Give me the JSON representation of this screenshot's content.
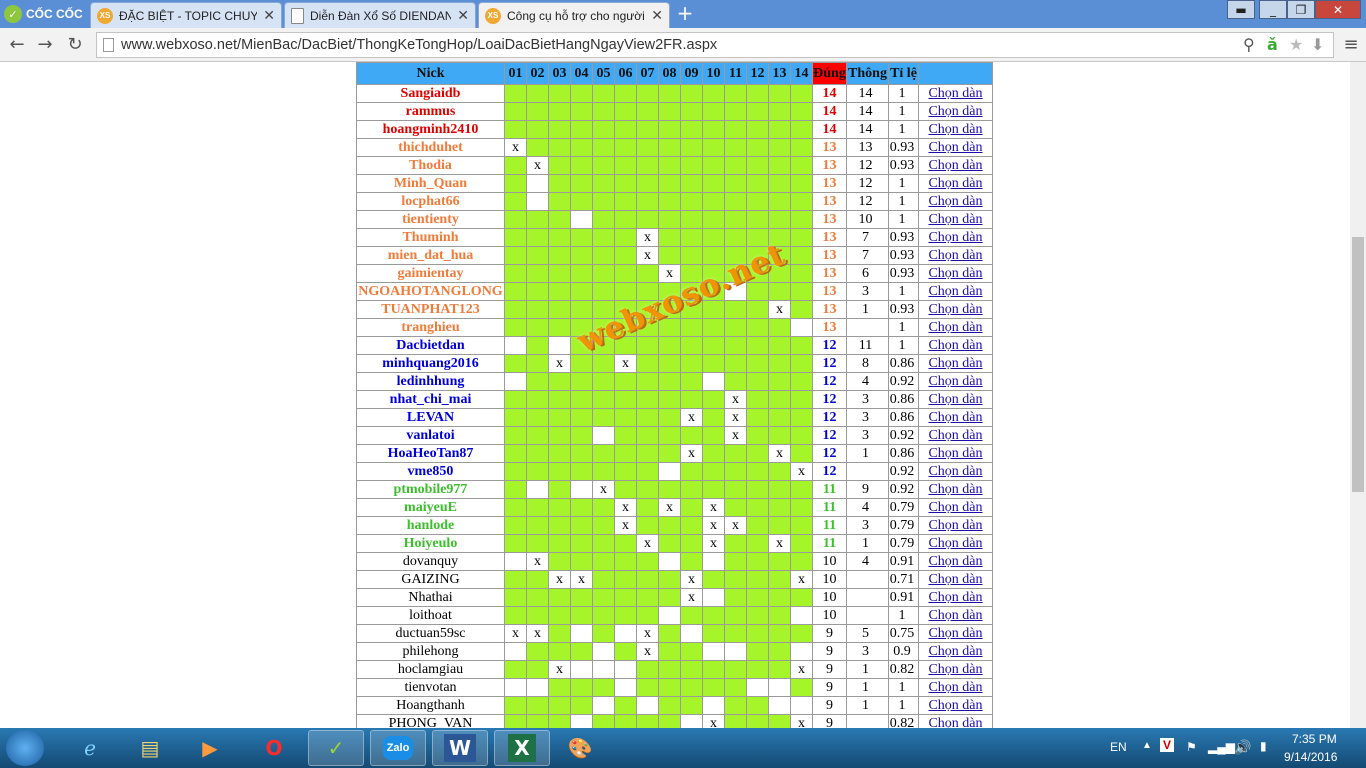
{
  "browser": {
    "brand": "CỐC CỐC",
    "tabs": [
      {
        "title": "ĐẶC BIỆT - TOPIC CHUYÊN",
        "icon": "xs-icon"
      },
      {
        "title": "Diễn Đàn Xổ Số DIENDAN",
        "icon": "page-icon"
      },
      {
        "title": "Công cụ hỗ trợ cho người",
        "icon": "xs-icon"
      }
    ],
    "url": "www.webxoso.net/MienBac/DacBiet/ThongKeTongHop/LoaiDacBietHangNgayView2FR.aspx"
  },
  "table": {
    "headers": {
      "nick": "Nick",
      "days": [
        "01",
        "02",
        "03",
        "04",
        "05",
        "06",
        "07",
        "08",
        "09",
        "10",
        "11",
        "12",
        "13",
        "14"
      ],
      "dung": "Đúng",
      "thong": "Thông",
      "tile": "Tỉ lệ"
    },
    "action_label": "Chọn dàn",
    "rows": [
      {
        "nick": "Sangiaidb",
        "color": "red",
        "cells": "gggggggggggggg",
        "dung": "14",
        "thong": "14",
        "tile": "1"
      },
      {
        "nick": "rammus",
        "color": "red",
        "cells": "gggggggggggggg",
        "dung": "14",
        "thong": "14",
        "tile": "1"
      },
      {
        "nick": "hoangminh2410",
        "color": "red",
        "cells": "gggggggggggggg",
        "dung": "14",
        "thong": "14",
        "tile": "1"
      },
      {
        "nick": "thichduhet",
        "color": "orange",
        "cells": "xggggggggggggg",
        "dung": "13",
        "thong": "13",
        "tile": "0.93"
      },
      {
        "nick": "Thodia",
        "color": "orange",
        "cells": "gxgggggggggggg",
        "dung": "13",
        "thong": "12",
        "tile": "0.93"
      },
      {
        "nick": "Minh_Quan",
        "color": "orange",
        "cells": "gwgggggggggggg",
        "dung": "13",
        "thong": "12",
        "tile": "1"
      },
      {
        "nick": "locphat66",
        "color": "orange",
        "cells": "gwgggggggggggg",
        "dung": "13",
        "thong": "12",
        "tile": "1"
      },
      {
        "nick": "tientienty",
        "color": "orange",
        "cells": "gggwgggggggggg",
        "dung": "13",
        "thong": "10",
        "tile": "1"
      },
      {
        "nick": "Thuminh",
        "color": "orange",
        "cells": "ggggggxggggggg",
        "dung": "13",
        "thong": "7",
        "tile": "0.93"
      },
      {
        "nick": "mien_dat_hua",
        "color": "orange",
        "cells": "ggggggxggggggg",
        "dung": "13",
        "thong": "7",
        "tile": "0.93"
      },
      {
        "nick": "gaimientay",
        "color": "orange",
        "cells": "gggggggxgggggg",
        "dung": "13",
        "thong": "6",
        "tile": "0.93"
      },
      {
        "nick": "NGOAHOTANGLONG",
        "color": "orange",
        "cells": "ggggggggggwggg",
        "dung": "13",
        "thong": "3",
        "tile": "1"
      },
      {
        "nick": "TUANPHAT123",
        "color": "orange",
        "cells": "ggggggggggggxg",
        "dung": "13",
        "thong": "1",
        "tile": "0.93"
      },
      {
        "nick": "tranghieu",
        "color": "orange",
        "cells": "gggggggggggggw",
        "dung": "13",
        "thong": "",
        "tile": "1"
      },
      {
        "nick": "Dacbietdan",
        "color": "blue",
        "cells": "wgwggggggggggg",
        "dung": "12",
        "thong": "11",
        "tile": "1"
      },
      {
        "nick": "minhquang2016",
        "color": "blue",
        "cells": "ggxggxgggggggg",
        "dung": "12",
        "thong": "8",
        "tile": "0.86"
      },
      {
        "nick": "ledinhhung",
        "color": "blue",
        "cells": "wggggggggwgggg",
        "dung": "12",
        "thong": "4",
        "tile": "0.92"
      },
      {
        "nick": "nhat_chi_mai",
        "color": "blue",
        "cells": "ggggggggggxggg",
        "dung": "12",
        "thong": "3",
        "tile": "0.86"
      },
      {
        "nick": "LEVAN",
        "color": "blue",
        "cells": "ggggggggxgxggg",
        "dung": "12",
        "thong": "3",
        "tile": "0.86"
      },
      {
        "nick": "vanlatoi",
        "color": "blue",
        "cells": "ggggwgggggxggg",
        "dung": "12",
        "thong": "3",
        "tile": "0.92"
      },
      {
        "nick": "HoaHeoTan87",
        "color": "blue",
        "cells": "ggggggggxgggxg",
        "dung": "12",
        "thong": "1",
        "tile": "0.86"
      },
      {
        "nick": "vme850",
        "color": "blue",
        "cells": "gggggggwgggggx",
        "dung": "12",
        "thong": "",
        "tile": "0.92"
      },
      {
        "nick": "ptmobile977",
        "color": "green",
        "cells": "gwgwxggggggggg",
        "dung": "11",
        "thong": "9",
        "tile": "0.92"
      },
      {
        "nick": "maiyeuE",
        "color": "green",
        "cells": "gggggxgxgxgggg",
        "dung": "11",
        "thong": "4",
        "tile": "0.79"
      },
      {
        "nick": "hanlode",
        "color": "green",
        "cells": "gggggxgggxxggg",
        "dung": "11",
        "thong": "3",
        "tile": "0.79"
      },
      {
        "nick": "Hoiyeulo",
        "color": "green",
        "cells": "ggggggxggxggxg",
        "dung": "11",
        "thong": "1",
        "tile": "0.79"
      },
      {
        "nick": "dovanquy",
        "color": "black",
        "cells": "wxgggggwgwgggg",
        "dung": "10",
        "thong": "4",
        "tile": "0.91"
      },
      {
        "nick": "GAIZING",
        "color": "black",
        "cells": "ggxxggggxggggx",
        "dung": "10",
        "thong": "",
        "tile": "0.71"
      },
      {
        "nick": "Nhathai",
        "color": "black",
        "cells": "ggggggggxwgggg",
        "dung": "10",
        "thong": "",
        "tile": "0.91"
      },
      {
        "nick": "loithoat",
        "color": "black",
        "cells": "gggggggwgggggw",
        "dung": "10",
        "thong": "",
        "tile": "1"
      },
      {
        "nick": "ductuan59sc",
        "color": "black",
        "cells": "xxgwgwxgwggggg",
        "dung": "9",
        "thong": "5",
        "tile": "0.75"
      },
      {
        "nick": "philehong",
        "color": "black",
        "cells": "wgggwgxggwwggw",
        "dung": "9",
        "thong": "3",
        "tile": "0.9"
      },
      {
        "nick": "hoclamgiau",
        "color": "black",
        "cells": "ggxwwwgggggggx",
        "dung": "9",
        "thong": "1",
        "tile": "0.82"
      },
      {
        "nick": "tienvotan",
        "color": "black",
        "cells": "wwgggwgggggwwg",
        "dung": "9",
        "thong": "1",
        "tile": "1"
      },
      {
        "nick": "Hoangthanh",
        "color": "black",
        "cells": "ggggwgwggwggww",
        "dung": "9",
        "thong": "1",
        "tile": "1"
      },
      {
        "nick": "PHONG_VAN",
        "color": "black",
        "cells": "gggwggggwxgggx",
        "dung": "9",
        "thong": "",
        "tile": "0.82"
      }
    ]
  },
  "watermark": "webxoso.net",
  "taskbar": {
    "lang": "EN",
    "time": "7:35 PM",
    "date": "9/14/2016",
    "apps": [
      "ie-icon",
      "file-explorer-icon",
      "media-player-icon",
      "opera-icon",
      "coccoc-icon",
      "zalo-icon",
      "word-icon",
      "excel-icon",
      "paint-icon"
    ],
    "zalo_label": "Zalo"
  }
}
